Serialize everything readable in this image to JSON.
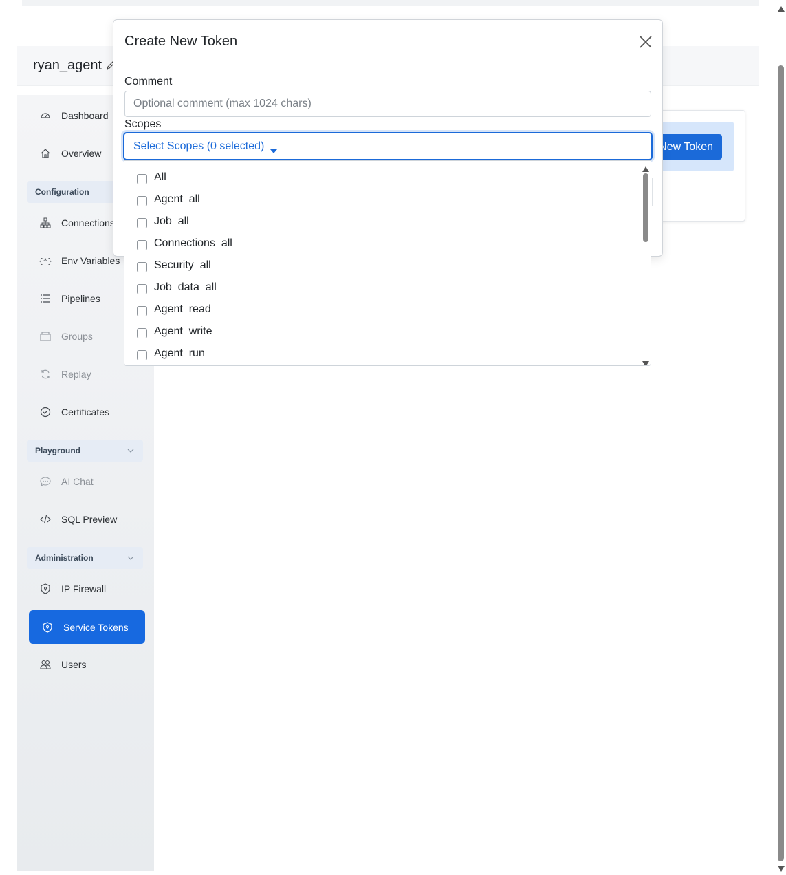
{
  "header": {
    "agent_name": "ryan_agent"
  },
  "sidebar": {
    "items": [
      {
        "label": "Dashboard",
        "icon": "gauge-icon"
      },
      {
        "label": "Overview",
        "icon": "home-icon"
      },
      {
        "label": "Connections",
        "icon": "network-icon"
      },
      {
        "label": "Env Variables",
        "icon": "braces-icon"
      },
      {
        "label": "Pipelines",
        "icon": "list-icon"
      },
      {
        "label": "Groups",
        "icon": "folder-icon"
      },
      {
        "label": "Replay",
        "icon": "refresh-icon"
      },
      {
        "label": "Certificates",
        "icon": "check-badge-icon"
      },
      {
        "label": "AI Chat",
        "icon": "chat-icon"
      },
      {
        "label": "SQL Preview",
        "icon": "code-icon"
      },
      {
        "label": "IP Firewall",
        "icon": "shield-icon"
      },
      {
        "label": "Service Tokens",
        "icon": "shield-icon"
      },
      {
        "label": "Users",
        "icon": "users-icon"
      }
    ],
    "sections": [
      {
        "label": "Configuration"
      },
      {
        "label": "Playground"
      },
      {
        "label": "Administration"
      }
    ],
    "active_item": "Service Tokens",
    "disabled_items": [
      "Groups",
      "Replay",
      "AI Chat"
    ]
  },
  "page": {
    "new_token_button": "New Token"
  },
  "modal": {
    "title": "Create New Token",
    "comment_label": "Comment",
    "comment_value": "",
    "comment_placeholder": "Optional comment (max 1024 chars)",
    "scopes_label": "Scopes",
    "scopes_select_text": "Select Scopes (0 selected)",
    "scope_options": [
      "All",
      "Agent_all",
      "Job_all",
      "Connections_all",
      "Security_all",
      "Job_data_all",
      "Agent_read",
      "Agent_write",
      "Agent_run"
    ]
  },
  "colors": {
    "accent": "#1b6ad9",
    "active_nav": "#1769e0",
    "section_bg": "#e6ecf5",
    "sidebar_bg": "#f4f5f7"
  }
}
